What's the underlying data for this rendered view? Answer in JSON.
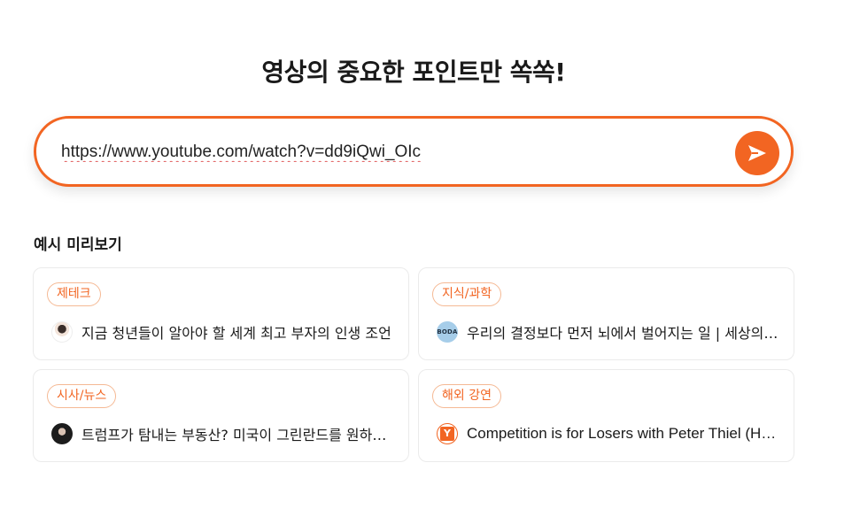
{
  "header": {
    "title": "영상의 중요한 포인트만 쏙쏙!"
  },
  "search": {
    "value": "https://www.youtube.com/watch?v=dd9iQwi_OIc",
    "submit_icon": "send-icon"
  },
  "examples": {
    "label": "예시 미리보기",
    "cards": [
      {
        "category": "제테크",
        "title": "지금 청년들이 알아야 할 세계 최고 부자의 인생 조언",
        "avatar_icon": "person-avatar"
      },
      {
        "category": "지식/과학",
        "title": "우리의 결정보다 먼저 뇌에서 벌어지는 일 | 세상의 …",
        "avatar_icon": "boda-logo",
        "avatar_text": "BODA"
      },
      {
        "category": "시사/뉴스",
        "title": "트럼프가 탐내는 부동산? 미국이 그린란드를 원하…",
        "avatar_icon": "person-avatar"
      },
      {
        "category": "해외 강연",
        "title": "Competition is for Losers with Peter Thiel (H…",
        "avatar_icon": "ycombinator-logo",
        "avatar_text": "Y"
      }
    ]
  },
  "colors": {
    "accent": "#f26522",
    "badge_border": "#f5b994",
    "card_border": "#ebebeb"
  }
}
